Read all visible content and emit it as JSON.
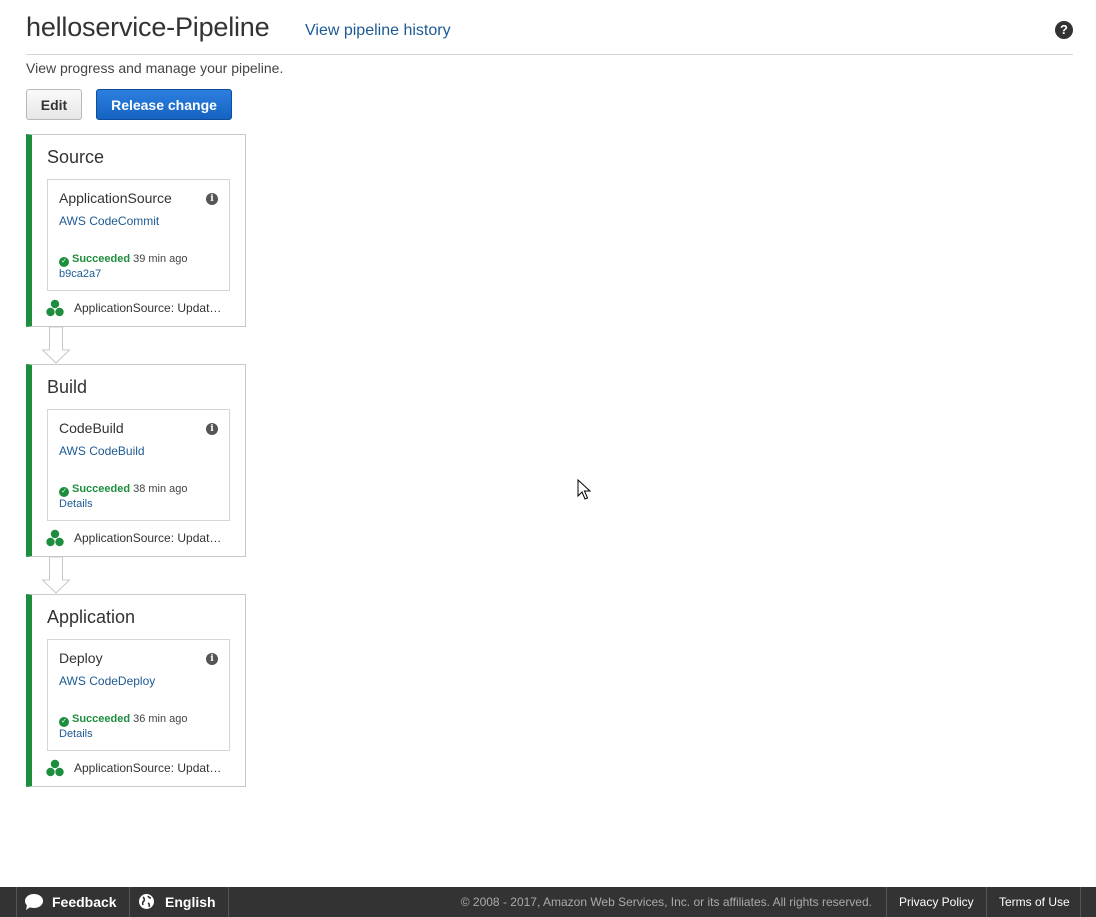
{
  "header": {
    "title": "helloservice-Pipeline",
    "history_link": "View pipeline history",
    "help_icon": "question-circle-icon"
  },
  "subtitle": "View progress and manage your pipeline.",
  "toolbar": {
    "edit_label": "Edit",
    "release_label": "Release change"
  },
  "stages": [
    {
      "name": "Source",
      "action": {
        "name": "ApplicationSource",
        "provider": "AWS CodeCommit",
        "status": "Succeeded",
        "time": "39 min ago",
        "detail": "b9ca2a7"
      },
      "revision": "ApplicationSource: Updated README.md"
    },
    {
      "name": "Build",
      "action": {
        "name": "CodeBuild",
        "provider": "AWS CodeBuild",
        "status": "Succeeded",
        "time": "38 min ago",
        "detail": "Details"
      },
      "revision": "ApplicationSource: Updated README.md"
    },
    {
      "name": "Application",
      "action": {
        "name": "Deploy",
        "provider": "AWS CodeDeploy",
        "status": "Succeeded",
        "time": "36 min ago",
        "detail": "Details"
      },
      "revision": "ApplicationSource: Updated README.md"
    }
  ],
  "footer": {
    "feedback": "Feedback",
    "language": "English",
    "copyright": "© 2008 - 2017, Amazon Web Services, Inc. or its affiliates. All rights reserved.",
    "privacy": "Privacy Policy",
    "terms": "Terms of Use"
  },
  "colors": {
    "success": "#1d8e3e",
    "link": "#1d5a94",
    "primary_button": "#1463c1",
    "footer_bg": "#333333"
  }
}
